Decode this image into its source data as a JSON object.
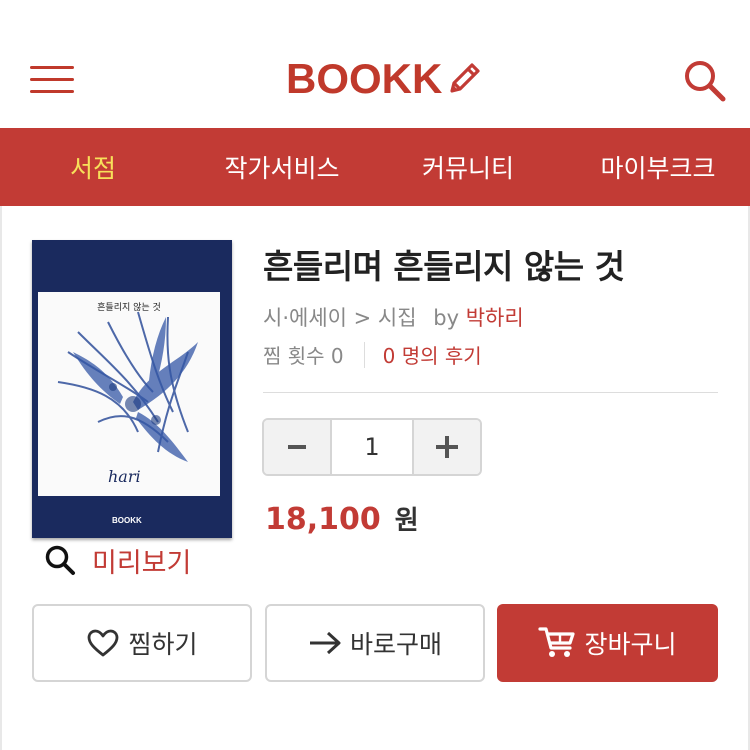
{
  "header": {
    "logo_text": "BOOKK",
    "logo_icon": "pencil-icon",
    "menu_icon": "hamburger-menu-icon",
    "search_icon": "search-icon",
    "brand_color": "#c23b35"
  },
  "nav": {
    "items": [
      {
        "label": "서점",
        "active": true
      },
      {
        "label": "작가서비스",
        "active": false
      },
      {
        "label": "커뮤니티",
        "active": false
      },
      {
        "label": "마이부크크",
        "active": false
      }
    ],
    "active_color": "#f7e05a"
  },
  "book": {
    "title": "흔들리며 흔들리지 않는 것",
    "category": "시·에세이 > 시집",
    "by_label": "by",
    "author": "박하리",
    "wish_count_label": "찜 횟수 0",
    "reviews_label": "0 명의 후기",
    "cover": {
      "title": "흔들리지 않는 것",
      "signature": "hari",
      "brand": "BOOKK",
      "bg_color": "#1a2a5e"
    },
    "preview_label": "미리보기",
    "quantity": "1",
    "price": "18,100",
    "currency": "원"
  },
  "actions": {
    "wish_label": "찜하기",
    "buy_label": "바로구매",
    "cart_label": "장바구니"
  }
}
